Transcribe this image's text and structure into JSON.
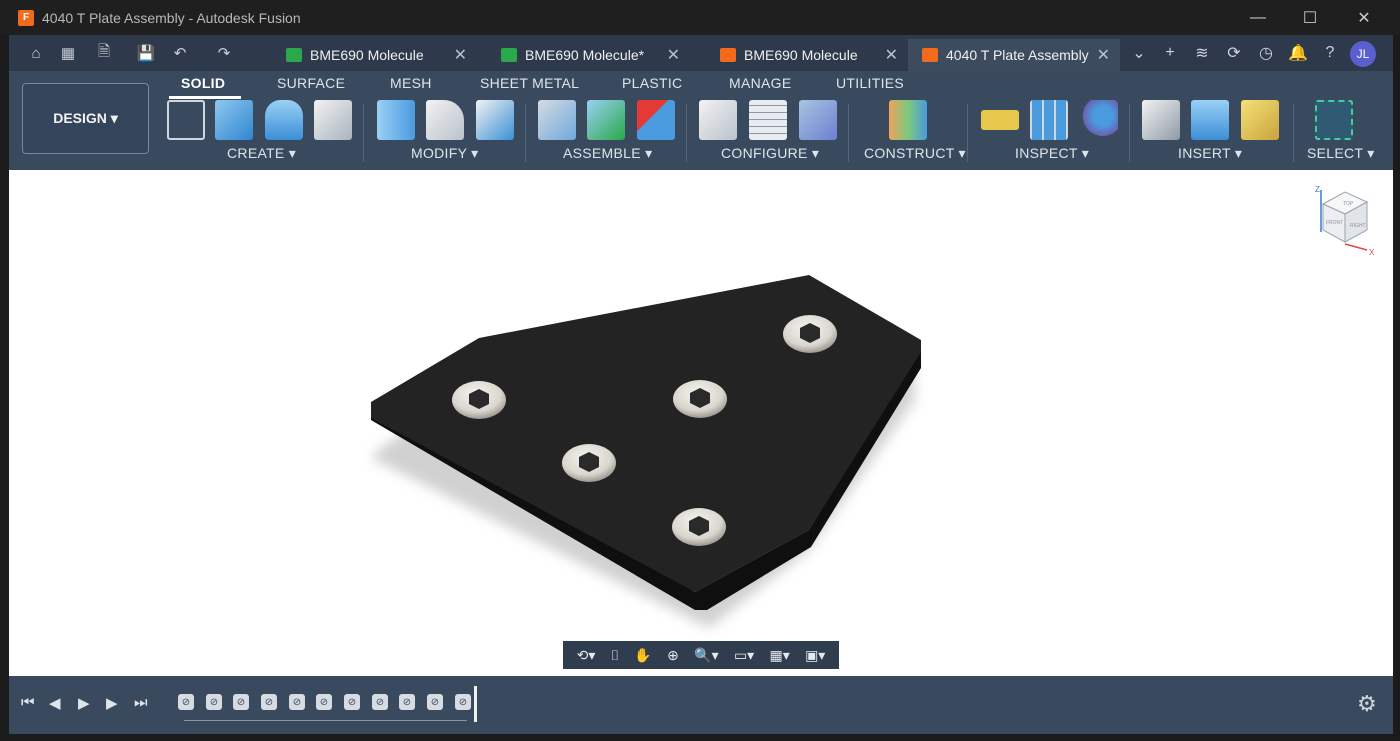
{
  "window": {
    "title": "4040 T Plate Assembly - Autodesk Fusion",
    "app_icon": "F",
    "minimize": "—",
    "maximize": "☐",
    "close": "✕"
  },
  "quick_access": {
    "home": "⌂",
    "grid": "▦",
    "file": "🗎",
    "save": "💾",
    "undo": "↶",
    "redo": "↷"
  },
  "tabs": [
    {
      "label": "BME690 Molecule",
      "close": "✕",
      "icon_color": "#2aa84a"
    },
    {
      "label": "BME690 Molecule*",
      "close": "✕",
      "icon_color": "#2aa84a"
    },
    {
      "label": "BME690 Molecule",
      "close": "✕",
      "icon_color": "#f26b1d"
    },
    {
      "label": "4040 T Plate Assembly",
      "close": "✕",
      "icon_color": "#f26b1d"
    }
  ],
  "right_tools": {
    "overflow": "⌄",
    "add": "+",
    "data": "≋",
    "extensions": "⟳",
    "history": "◷",
    "notifications": "🔔",
    "help": "?",
    "avatar": "JL"
  },
  "workspace": {
    "label": "DESIGN ▾"
  },
  "ribbon_tabs": [
    "SOLID",
    "SURFACE",
    "MESH",
    "SHEET METAL",
    "PLASTIC",
    "MANAGE",
    "UTILITIES"
  ],
  "groups": [
    "CREATE ▾",
    "MODIFY ▾",
    "ASSEMBLE ▾",
    "CONFIGURE ▾",
    "CONSTRUCT ▾",
    "INSPECT ▾",
    "INSERT ▾",
    "SELECT ▾"
  ],
  "viewcube": {
    "top": "TOP",
    "front": "FRONT",
    "right": "RIGHT",
    "z": "Z",
    "x": "X"
  },
  "nav_bar": [
    "⟲▾",
    "⌷",
    "✋",
    "⊕",
    "🔍▾",
    "▭▾",
    "▦▾",
    "▣▾"
  ],
  "timeline": {
    "first": "⏮",
    "prev": "◀",
    "play": "▶",
    "next": "▶",
    "last": "⏭",
    "feature": "⊘",
    "settings": "⚙"
  },
  "colors": {
    "accent": "#f26b1d",
    "ribbon": "#3a4a5e",
    "plate": "#1c1c1c",
    "screw": "#d9d6cf"
  }
}
